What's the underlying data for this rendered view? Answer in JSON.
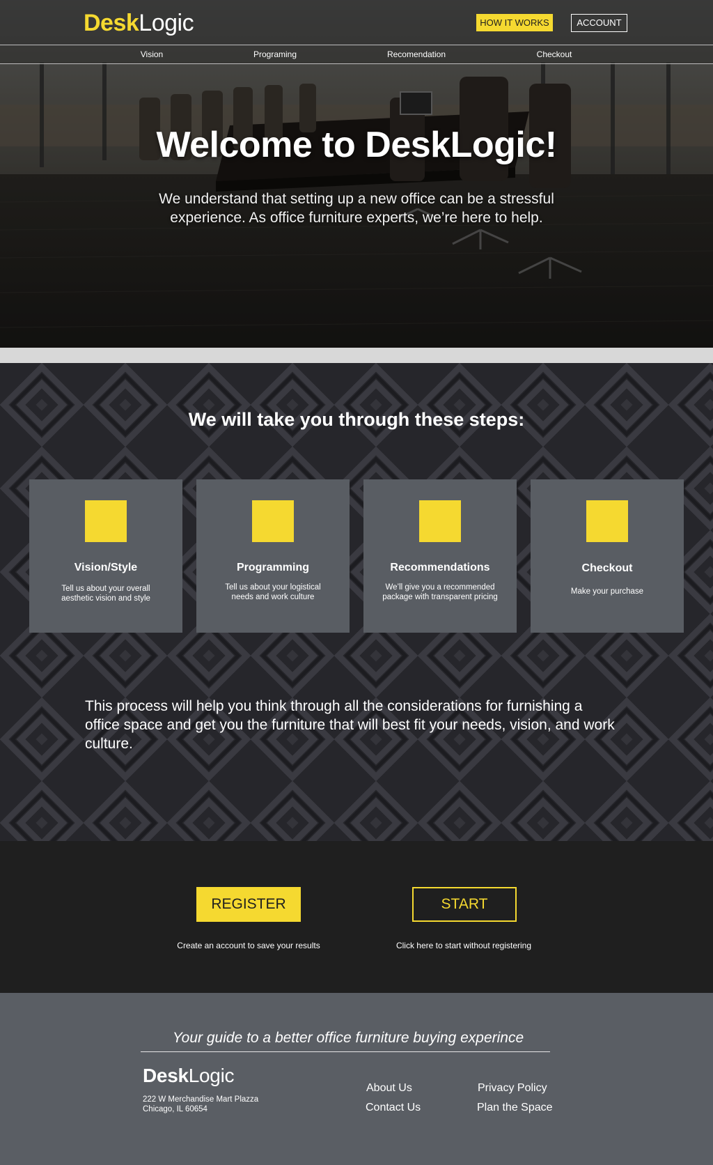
{
  "header": {
    "logo_bold": "Desk",
    "logo_regular": "Logic",
    "how_it_works": "HOW IT WORKS",
    "account": "ACCOUNT"
  },
  "nav": {
    "items": [
      "Vision",
      "Programing",
      "Recomendation",
      "Checkout"
    ]
  },
  "hero": {
    "title_prefix": "Welcome to ",
    "title_bold": "Desk",
    "title_regular": "Logic!",
    "subtitle": "We understand that setting up a new office can be a stressful experience. As office furniture experts, we’re here to help."
  },
  "steps": {
    "title": "We will take you through these steps:",
    "cards": [
      {
        "title": "Vision/Style",
        "desc": "Tell us about your overall aesthetic vision and style"
      },
      {
        "title": "Programming",
        "desc": "Tell us about your logistical needs and work culture"
      },
      {
        "title": "Recommendations",
        "desc": "We’ll give you a recommended package with transparent pricing"
      },
      {
        "title": "Checkout",
        "desc": "Make your purchase"
      }
    ],
    "text": "This process will help you think through all the considerations for furnishing a office space and get you the furniture that will best fit your needs, vision, and work culture."
  },
  "cta": {
    "register": "REGISTER",
    "register_caption": "Create an account to save your results",
    "start": "START",
    "start_caption": "Click here to start without registering"
  },
  "footer": {
    "tagline": "Your guide to a better office furniture buying experince",
    "logo_bold": "Desk",
    "logo_regular": "Logic",
    "address_line1": "222 W Merchandise Mart Plazza",
    "address_line2": "Chicago, IL 60654",
    "links": [
      "About Us",
      "Contact Us",
      "Privacy Policy",
      "Plan the Space"
    ]
  },
  "colors": {
    "accent": "#f5d930",
    "dark": "#1f1f1f",
    "card": "#595d63",
    "footer": "#5a5e64"
  }
}
